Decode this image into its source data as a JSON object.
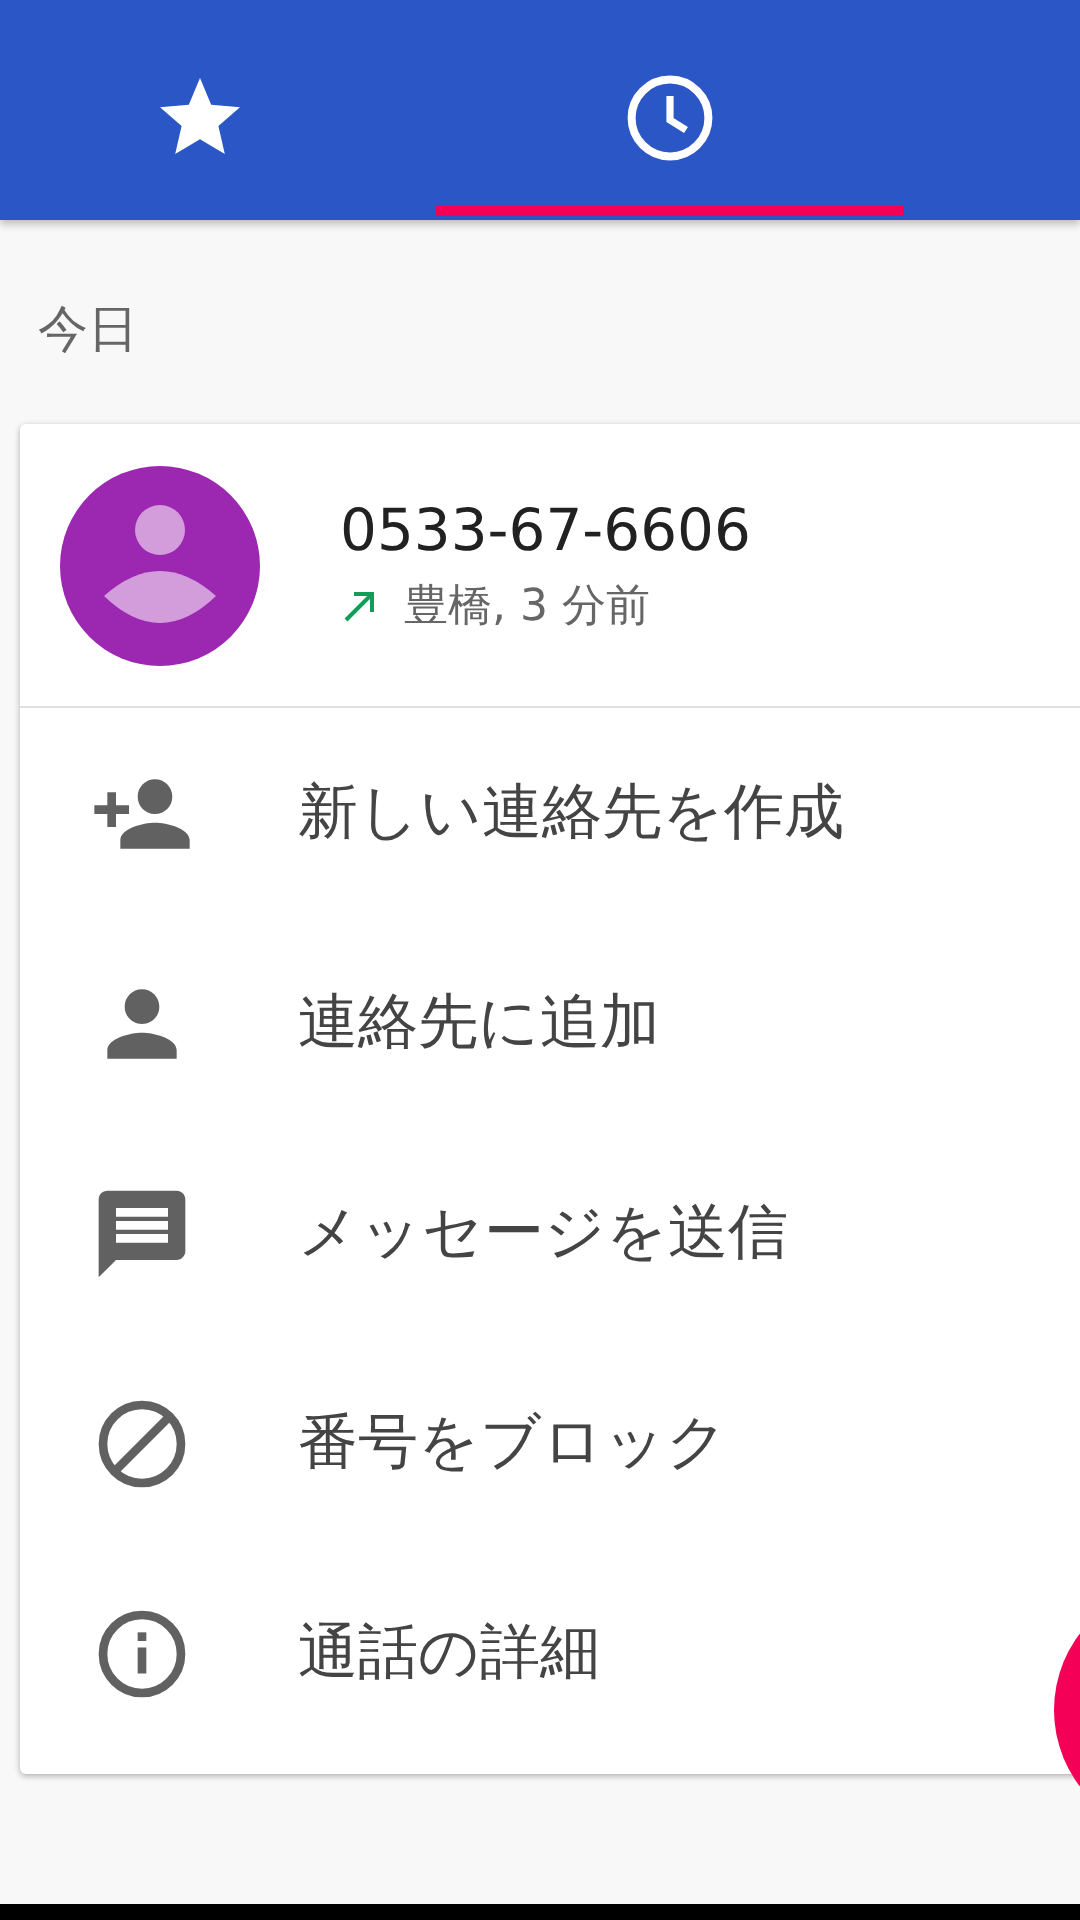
{
  "tabs": [
    {
      "kind": "star",
      "selected": false
    },
    {
      "kind": "clock",
      "selected": true
    }
  ],
  "section_title": "今日",
  "call": {
    "number": "0533-67-6606",
    "outgoing": true,
    "details": "豊橋, 3 分前"
  },
  "actions": [
    {
      "kind": "add-contact",
      "label": "新しい連絡先を作成"
    },
    {
      "kind": "contact",
      "label": "連絡先に追加"
    },
    {
      "kind": "message",
      "label": "メッセージを送信"
    },
    {
      "kind": "block",
      "label": "番号をブロック"
    },
    {
      "kind": "info",
      "label": "通話の詳細"
    }
  ]
}
